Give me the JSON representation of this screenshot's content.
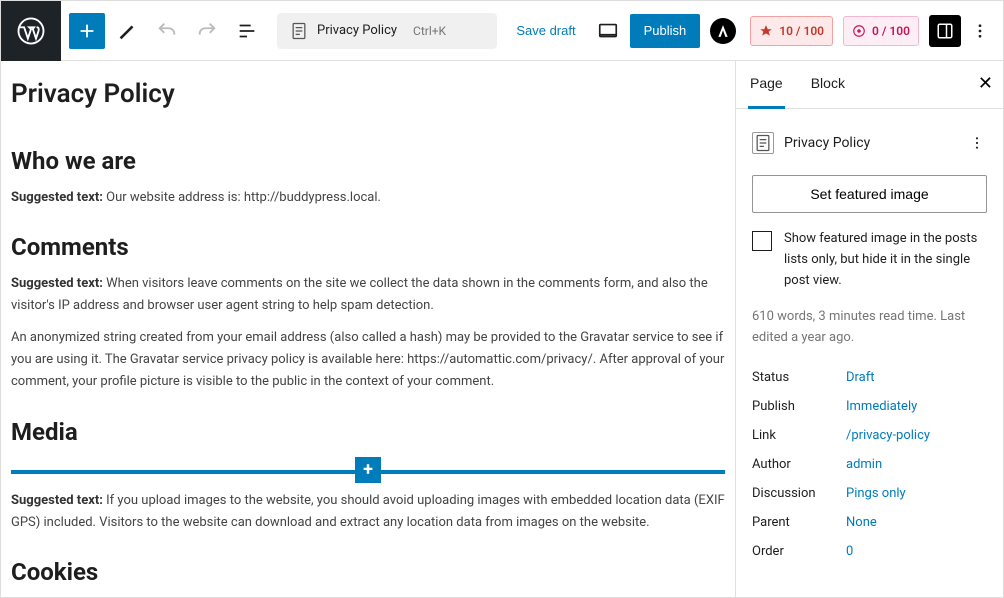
{
  "topbar": {
    "doc_title": "Privacy Policy",
    "shortcut": "Ctrl+K",
    "save_draft": "Save draft",
    "publish": "Publish",
    "score1": "10 / 100",
    "score2": "0 / 100"
  },
  "page": {
    "title": "Privacy Policy",
    "h_who": "Who we are",
    "p_who_prefix": "Suggested text: ",
    "p_who": "Our website address is: http://buddypress.local.",
    "h_comments": "Comments",
    "p_comments1_prefix": "Suggested text: ",
    "p_comments1": "When visitors leave comments on the site we collect the data shown in the comments form, and also the visitor's IP address and browser user agent string to help spam detection.",
    "p_comments2": "An anonymized string created from your email address (also called a hash) may be provided to the Gravatar service to see if you are using it. The Gravatar service privacy policy is available here: https://automattic.com/privacy/. After approval of your comment, your profile picture is visible to the public in the context of your comment.",
    "h_media": "Media",
    "p_media_prefix": "Suggested text: ",
    "p_media": "If you upload images to the website, you should avoid uploading images with embedded location data (EXIF GPS) included. Visitors to the website can download and extract any location data from images on the website.",
    "h_cookies": "Cookies"
  },
  "sidebar": {
    "tab_page": "Page",
    "tab_block": "Block",
    "doc_name": "Privacy Policy",
    "featured_btn": "Set featured image",
    "chk_label": "Show featured image in the posts lists only, but hide it in the single post view.",
    "meta": "610 words, 3 minutes read time. Last edited a year ago.",
    "rows": {
      "status_k": "Status",
      "status_v": "Draft",
      "publish_k": "Publish",
      "publish_v": "Immediately",
      "link_k": "Link",
      "link_v": "/privacy-policy",
      "author_k": "Author",
      "author_v": "admin",
      "discussion_k": "Discussion",
      "discussion_v": "Pings only",
      "parent_k": "Parent",
      "parent_v": "None",
      "order_k": "Order",
      "order_v": "0"
    }
  }
}
